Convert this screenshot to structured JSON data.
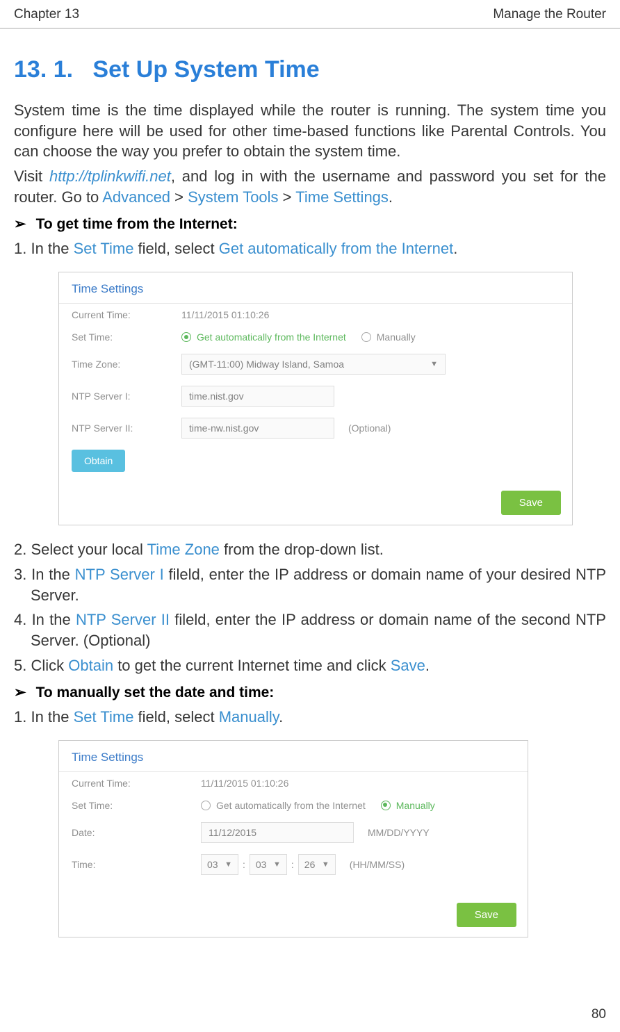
{
  "header": {
    "chapter": "Chapter 13",
    "title": "Manage the Router"
  },
  "section": {
    "number": "13. 1.",
    "name": "Set Up System Time"
  },
  "intro": {
    "p1a": "System time is the time displayed while the router is running. The system time you configure here will be used for other time-based functions like Parental Controls. You can choose the  way you prefer to obtain the system time.",
    "p2a": "Visit ",
    "p2link": "http://tplinkwifi.net",
    "p2b": ", and log in with the username and password you set for the router. Go to ",
    "p2nav1": "Advanced",
    "p2sep": " > ",
    "p2nav2": "System Tools",
    "p2nav3": "Time Settings",
    "p2end": "."
  },
  "sub1": {
    "heading": "To get time from the Internet:",
    "s1a": "1. In the ",
    "s1ui1": "Set Time",
    "s1b": " field, select ",
    "s1ui2": "Get automatically from the Internet",
    "s1c": ".",
    "s2a": "2. Select your local ",
    "s2ui": "Time Zone",
    "s2b": " from the drop-down list.",
    "s3a": "3. In the ",
    "s3ui": "NTP Server I",
    "s3b": " fileld, enter the IP address or domain name of your desired NTP Server.",
    "s4a": "4. In the ",
    "s4ui": "NTP Server II",
    "s4b": " fileld, enter the IP address or domain name of the second NTP Server. (Optional)",
    "s5a": "5. Click ",
    "s5ui1": "Obtain",
    "s5b": " to get the current Internet time and click ",
    "s5ui2": "Save",
    "s5c": "."
  },
  "sub2": {
    "heading": "To manually set the date and time:",
    "s1a": "1. In the ",
    "s1ui1": "Set Time",
    "s1b": " field, select ",
    "s1ui2": "Manually",
    "s1c": "."
  },
  "panel1": {
    "title": "Time Settings",
    "currentTimeLabel": "Current Time:",
    "currentTimeValue": "11/11/2015 01:10:26",
    "setTimeLabel": "Set Time:",
    "autoLabel": "Get automatically from the Internet",
    "manualLabel": "Manually",
    "tzLabel": "Time Zone:",
    "tzValue": "(GMT-11:00) Midway Island, Samoa",
    "ntp1Label": "NTP Server I:",
    "ntp1Value": "time.nist.gov",
    "ntp2Label": "NTP Server II:",
    "ntp2Value": "time-nw.nist.gov",
    "optional": "(Optional)",
    "obtainBtn": "Obtain",
    "saveBtn": "Save"
  },
  "panel2": {
    "title": "Time Settings",
    "currentTimeLabel": "Current Time:",
    "currentTimeValue": "11/11/2015 01:10:26",
    "setTimeLabel": "Set Time:",
    "autoLabel": "Get automatically from the Internet",
    "manualLabel": "Manually",
    "dateLabel": "Date:",
    "dateValue": "11/12/2015",
    "dateHint": "MM/DD/YYYY",
    "timeLabel": "Time:",
    "timeHH": "03",
    "timeMM": "03",
    "timeSS": "26",
    "timeHint": "(HH/MM/SS)",
    "saveBtn": "Save"
  },
  "pageNumber": "80"
}
